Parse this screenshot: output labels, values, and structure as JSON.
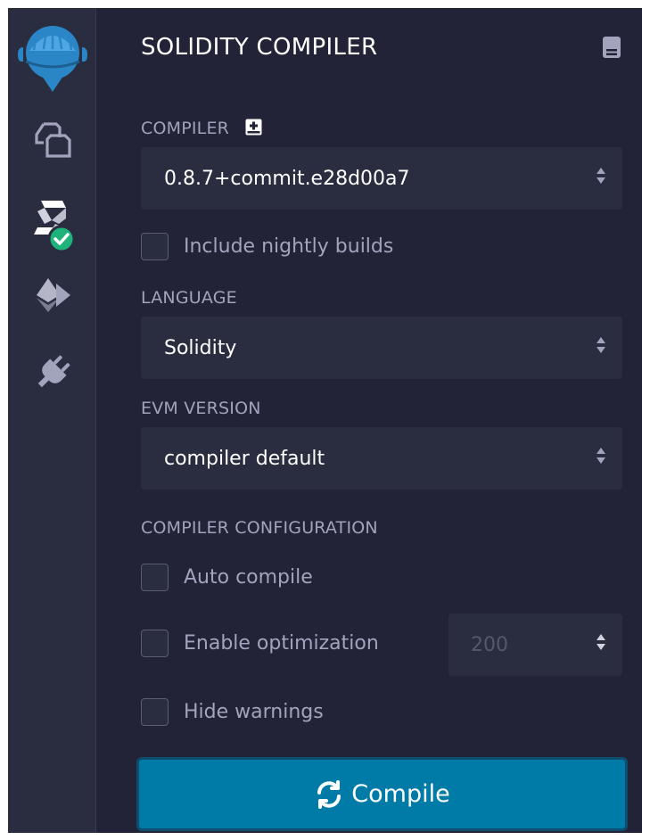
{
  "window": {
    "title": "SOLIDITY COMPILER"
  },
  "icons": {
    "logo": "remix-logo-icon",
    "file_explorer": "file-explorer-icon",
    "compiler": "solidity-compiler-icon",
    "compiler_status": "check-circle-icon",
    "deploy": "deploy-run-icon",
    "plugin": "plugin-manager-icon",
    "docs": "documentation-icon",
    "add_compiler": "plus-square-icon",
    "compile": "refresh-icon"
  },
  "compiler": {
    "label": "COMPILER",
    "version": "0.8.7+commit.e28d00a7",
    "nightly_label": "Include nightly builds",
    "nightly_checked": false
  },
  "language": {
    "label": "LANGUAGE",
    "value": "Solidity"
  },
  "evm": {
    "label": "EVM VERSION",
    "value": "compiler default"
  },
  "config": {
    "label": "COMPILER CONFIGURATION",
    "auto_compile": {
      "label": "Auto compile",
      "checked": false
    },
    "optimization": {
      "label": "Enable optimization",
      "checked": false,
      "runs": "200"
    },
    "hide_warnings": {
      "label": "Hide warnings",
      "checked": false
    }
  },
  "compile_button": {
    "label": "Compile"
  },
  "colors": {
    "background": "#222336",
    "sidebar": "#2a2c3f",
    "accent": "#007aa6",
    "success": "#1db37b",
    "logo": "#2a86c7"
  }
}
